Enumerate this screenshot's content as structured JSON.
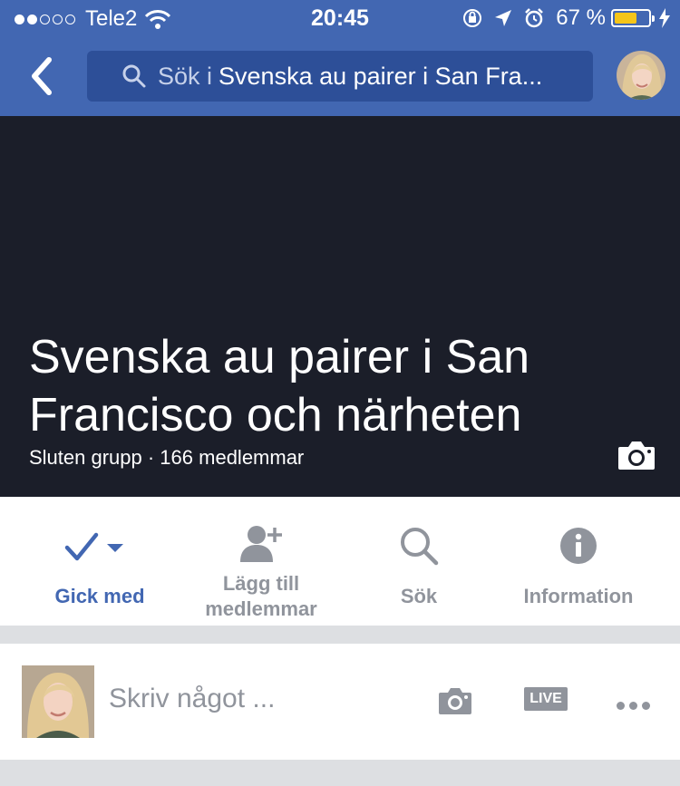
{
  "status_bar": {
    "carrier": "Tele2",
    "time": "20:45",
    "battery": "67 %",
    "battery_level": 0.67
  },
  "nav": {
    "search_prefix": "Sök i",
    "search_group": "Svenska au pairer i San Fra..."
  },
  "group": {
    "title": "Svenska au pairer i San Francisco och närheten",
    "subtitle": "Sluten grupp · 166 medlemmar"
  },
  "actions": [
    {
      "label": "Gick med",
      "icon": "check-icon"
    },
    {
      "label": "Lägg till medlemmar",
      "icon": "add-person-icon"
    },
    {
      "label": "Sök",
      "icon": "search-icon"
    },
    {
      "label": "Information",
      "icon": "info-icon"
    }
  ],
  "composer": {
    "placeholder": "Skriv något ...",
    "live_label": "LIVE"
  },
  "colors": {
    "brand_blue": "#4267b2",
    "cover_bg": "#1b1e29",
    "muted_gray": "#90949c",
    "divider_gray": "#dddfe2"
  }
}
